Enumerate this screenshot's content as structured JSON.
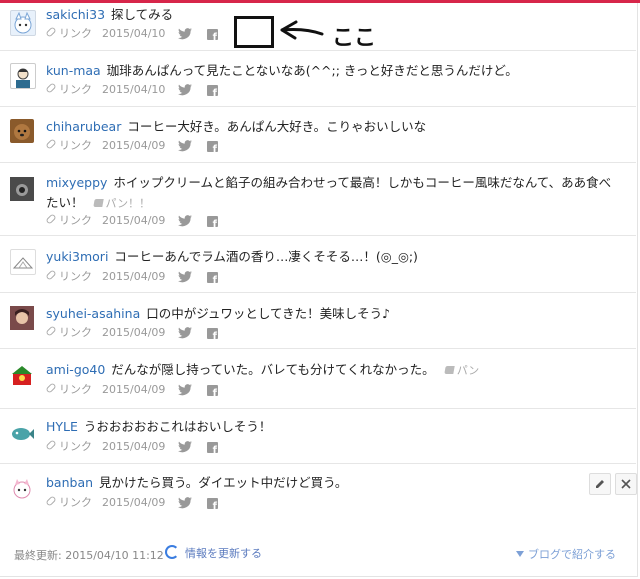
{
  "comments": [
    {
      "user": "sakichi33",
      "text": "探してみる",
      "meta": "リンク",
      "date": "2015/04/10"
    },
    {
      "user": "kun-maa",
      "text": "珈琲あんぱんって見たことないなあ(^^;; きっと好きだと思うんだけど。",
      "meta": "リンク",
      "date": "2015/04/10"
    },
    {
      "user": "chiharubear",
      "text": "コーヒー大好き。あんぱん大好き。こりゃおいしいな",
      "meta": "リンク",
      "date": "2015/04/09"
    },
    {
      "user": "mixyeppy",
      "text": "ホイップクリームと餡子の組み合わせって最高！しかもコーヒー風味だなんて、ああ食べたい！",
      "tag": "パン！！",
      "meta": "リンク",
      "date": "2015/04/09"
    },
    {
      "user": "yuki3mori",
      "text": "コーヒーあんでラム酒の香り…凄くそそる…！(◎_◎;)",
      "meta": "リンク",
      "date": "2015/04/09"
    },
    {
      "user": "syuhei-asahina",
      "text": "口の中がジュワッとしてきた！美味しそう♪",
      "meta": "リンク",
      "date": "2015/04/09"
    },
    {
      "user": "ami-go40",
      "text": "だんなが隠し持っていた。バレても分けてくれなかった。",
      "tag": "パン",
      "meta": "リンク",
      "date": "2015/04/09"
    },
    {
      "user": "HYLE",
      "text": "うおおおおおこれはおいしそう！",
      "meta": "リンク",
      "date": "2015/04/09"
    },
    {
      "user": "banban",
      "text": "見かけたら買う。ダイエット中だけど買う。",
      "meta": "リンク",
      "date": "2015/04/09"
    }
  ],
  "footer": {
    "last_updated": "最終更新: 2015/04/10 11:12",
    "refresh_label": "情報を更新する",
    "blog_label": "ブログで紹介する"
  },
  "annotation": {
    "label": "ここ"
  },
  "colors": {
    "accent": "#d7264a",
    "username": "#2e6db4",
    "meta": "#999999"
  }
}
